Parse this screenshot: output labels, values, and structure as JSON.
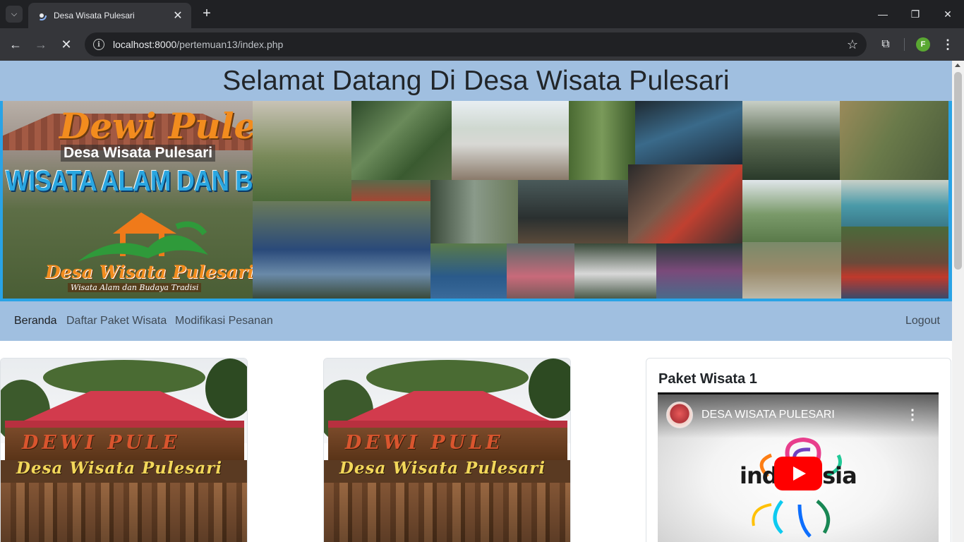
{
  "browser": {
    "tab_title": "Desa Wisata Pulesari",
    "url_host": "localhost:8000",
    "url_path": "/pertemuan13/index.php",
    "profile_initial": "F"
  },
  "page": {
    "heading": "Selamat Datang Di Desa Wisata Pulesari",
    "banner": {
      "brand": "Dewi Pule",
      "subtitle": "Desa Wisata Pulesari",
      "slogan": "WISATA ALAM DAN BUDAYA TRADISI",
      "logo_text": "Desa Wisata Pulesari",
      "tagline": "Wisata Alam dan Budaya Tradisi"
    },
    "nav": {
      "items": [
        {
          "label": "Beranda",
          "active": true
        },
        {
          "label": "Daftar Paket Wisata",
          "active": false
        },
        {
          "label": "Modifikasi Pesanan",
          "active": false
        }
      ],
      "logout": "Logout"
    },
    "gate_photo": {
      "top_text": "DEWI PULE",
      "bottom_text": "Desa Wisata Pulesari"
    },
    "video_card": {
      "title": "Paket Wisata 1",
      "video_title": "DESA WISATA PULESARI",
      "logo_word": "indonesia"
    }
  },
  "colors": {
    "header_bg": "#a0bfe0",
    "banner_border": "#29a3e6",
    "chrome_dark": "#202124",
    "chrome_mid": "#35363a",
    "youtube_red": "#ff0000"
  }
}
